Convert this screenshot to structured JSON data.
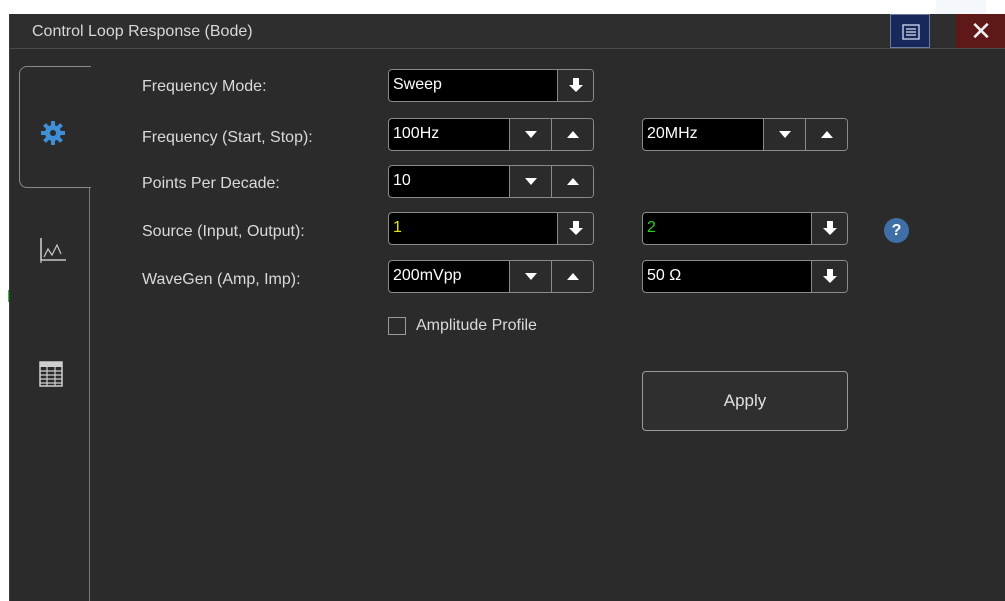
{
  "window": {
    "title": "Control Loop Response (Bode)",
    "icons": {
      "menu": "menu-list-icon",
      "close": "close-icon"
    },
    "close_glyph": "✕"
  },
  "tabs": [
    {
      "name": "settings",
      "icon": "gear-icon",
      "active": true
    },
    {
      "name": "chart",
      "icon": "chart-icon",
      "active": false
    },
    {
      "name": "table",
      "icon": "table-icon",
      "active": false
    }
  ],
  "form": {
    "frequency_mode": {
      "label": "Frequency Mode:",
      "value": "Sweep"
    },
    "frequency": {
      "label": "Frequency (Start, Stop):",
      "start": "100Hz",
      "stop": "20MHz"
    },
    "points_per_decade": {
      "label": "Points Per Decade:",
      "value": "10"
    },
    "source": {
      "label": "Source (Input, Output):",
      "input": "1",
      "output": "2",
      "input_color": "#e6e600",
      "output_color": "#22d322"
    },
    "wavegen": {
      "label": "WaveGen (Amp, Imp):",
      "amp": "200mVpp",
      "imp": "50 Ω"
    },
    "amplitude_profile": {
      "label": "Amplitude Profile",
      "checked": false
    },
    "help": "?",
    "apply": "Apply"
  },
  "colors": {
    "background": "#2b2b2b",
    "accent": "#3f8fd6",
    "help_badge": "#3f6fa6",
    "menu_button": "#16295a",
    "close_button": "#5e1818"
  }
}
